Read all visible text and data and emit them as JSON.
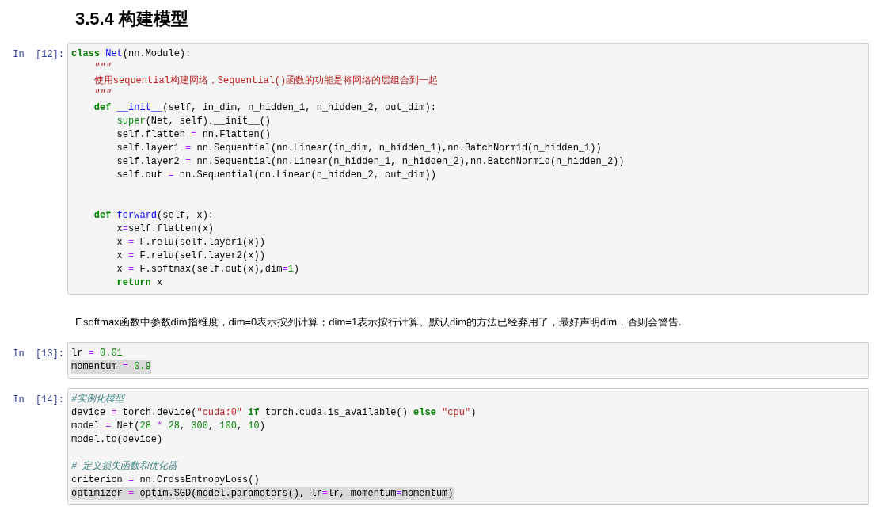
{
  "heading": "3.5.4 构建模型",
  "cells": [
    {
      "kind": "code",
      "prompt": "In  [12]:",
      "lines": [
        {
          "highlighted": false,
          "spans": [
            {
              "kind": "kw",
              "text": "class"
            },
            {
              "kind": "def",
              "text": " Net"
            },
            {
              "kind": "plain",
              "text": "(nn.Module):"
            }
          ]
        },
        {
          "highlighted": false,
          "spans": [
            {
              "kind": "doc",
              "text": "    \"\"\""
            }
          ]
        },
        {
          "highlighted": false,
          "spans": [
            {
              "kind": "str",
              "text": "    使用sequential构建网络，Sequential()函数的功能是将网络的层组合到一起"
            }
          ]
        },
        {
          "highlighted": false,
          "spans": [
            {
              "kind": "doc",
              "text": "    \"\"\""
            }
          ]
        },
        {
          "highlighted": false,
          "spans": [
            {
              "kind": "kw",
              "text": "    def"
            },
            {
              "kind": "def",
              "text": " __init__"
            },
            {
              "kind": "plain",
              "text": "(self, in_dim, n_hidden_1, n_hidden_2, out_dim):"
            }
          ]
        },
        {
          "highlighted": false,
          "spans": [
            {
              "kind": "builtin",
              "text": "        super"
            },
            {
              "kind": "plain",
              "text": "(Net, self).__init__()"
            }
          ]
        },
        {
          "highlighted": false,
          "spans": [
            {
              "kind": "plain",
              "text": "        self.flatten "
            },
            {
              "kind": "op",
              "text": "="
            },
            {
              "kind": "plain",
              "text": " nn.Flatten()"
            }
          ]
        },
        {
          "highlighted": false,
          "spans": [
            {
              "kind": "plain",
              "text": "        self.layer1 "
            },
            {
              "kind": "op",
              "text": "="
            },
            {
              "kind": "plain",
              "text": " nn.Sequential(nn.Linear(in_dim, n_hidden_1),nn.BatchNorm1d(n_hidden_1))"
            }
          ]
        },
        {
          "highlighted": false,
          "spans": [
            {
              "kind": "plain",
              "text": "        self.layer2 "
            },
            {
              "kind": "op",
              "text": "="
            },
            {
              "kind": "plain",
              "text": " nn.Sequential(nn.Linear(n_hidden_1, n_hidden_2),nn.BatchNorm1d(n_hidden_2))"
            }
          ]
        },
        {
          "highlighted": false,
          "spans": [
            {
              "kind": "plain",
              "text": "        self.out "
            },
            {
              "kind": "op",
              "text": "="
            },
            {
              "kind": "plain",
              "text": " nn.Sequential(nn.Linear(n_hidden_2, out_dim))"
            }
          ]
        },
        {
          "kind": "blank"
        },
        {
          "kind": "blank"
        },
        {
          "highlighted": false,
          "spans": [
            {
              "kind": "kw",
              "text": "    def"
            },
            {
              "kind": "def",
              "text": " forward"
            },
            {
              "kind": "plain",
              "text": "(self, x):"
            }
          ]
        },
        {
          "highlighted": false,
          "spans": [
            {
              "kind": "plain",
              "text": "        x"
            },
            {
              "kind": "op",
              "text": "="
            },
            {
              "kind": "plain",
              "text": "self.flatten(x)"
            }
          ]
        },
        {
          "highlighted": false,
          "spans": [
            {
              "kind": "plain",
              "text": "        x "
            },
            {
              "kind": "op",
              "text": "="
            },
            {
              "kind": "plain",
              "text": " F.relu(self.layer1(x))"
            }
          ]
        },
        {
          "highlighted": false,
          "spans": [
            {
              "kind": "plain",
              "text": "        x "
            },
            {
              "kind": "op",
              "text": "="
            },
            {
              "kind": "plain",
              "text": " F.relu(self.layer2(x))"
            }
          ]
        },
        {
          "highlighted": false,
          "spans": [
            {
              "kind": "plain",
              "text": "        x "
            },
            {
              "kind": "op",
              "text": "="
            },
            {
              "kind": "plain",
              "text": " F.softmax(self.out(x),dim"
            },
            {
              "kind": "op",
              "text": "="
            },
            {
              "kind": "num",
              "text": "1"
            },
            {
              "kind": "plain",
              "text": ")"
            }
          ]
        },
        {
          "highlighted": false,
          "spans": [
            {
              "kind": "kw",
              "text": "        return"
            },
            {
              "kind": "plain",
              "text": " x"
            }
          ]
        }
      ]
    },
    {
      "kind": "markdown",
      "text": "F.softmax函数中参数dim指维度，dim=0表示按列计算；dim=1表示按行计算。默认dim的方法已经弃用了，最好声明dim，否则会警告."
    },
    {
      "kind": "code",
      "prompt": "In  [13]:",
      "lines": [
        {
          "highlighted": false,
          "spans": [
            {
              "kind": "plain",
              "text": "lr "
            },
            {
              "kind": "op",
              "text": "="
            },
            {
              "kind": "num",
              "text": " 0.01"
            }
          ]
        },
        {
          "highlighted": true,
          "spans": [
            {
              "kind": "plain",
              "text": "momentum "
            },
            {
              "kind": "op",
              "text": "="
            },
            {
              "kind": "num",
              "text": " 0.9"
            }
          ]
        }
      ]
    },
    {
      "kind": "code",
      "prompt": "In  [14]:",
      "lines": [
        {
          "highlighted": false,
          "spans": [
            {
              "kind": "comment",
              "text": "#实例化模型"
            }
          ]
        },
        {
          "highlighted": false,
          "spans": [
            {
              "kind": "plain",
              "text": "device "
            },
            {
              "kind": "op",
              "text": "="
            },
            {
              "kind": "plain",
              "text": " torch.device("
            },
            {
              "kind": "str",
              "text": "\"cuda:0\""
            },
            {
              "kind": "kw",
              "text": " if"
            },
            {
              "kind": "plain",
              "text": " torch.cuda.is_available() "
            },
            {
              "kind": "kw",
              "text": "else"
            },
            {
              "kind": "str",
              "text": " \"cpu\""
            },
            {
              "kind": "plain",
              "text": ")"
            }
          ]
        },
        {
          "highlighted": false,
          "spans": [
            {
              "kind": "plain",
              "text": "model "
            },
            {
              "kind": "op",
              "text": "="
            },
            {
              "kind": "plain",
              "text": " Net("
            },
            {
              "kind": "num",
              "text": "28"
            },
            {
              "kind": "op",
              "text": " *"
            },
            {
              "kind": "num",
              "text": " 28"
            },
            {
              "kind": "plain",
              "text": ", "
            },
            {
              "kind": "num",
              "text": "300"
            },
            {
              "kind": "plain",
              "text": ", "
            },
            {
              "kind": "num",
              "text": "100"
            },
            {
              "kind": "plain",
              "text": ", "
            },
            {
              "kind": "num",
              "text": "10"
            },
            {
              "kind": "plain",
              "text": ")"
            }
          ]
        },
        {
          "highlighted": false,
          "spans": [
            {
              "kind": "plain",
              "text": "model.to(device)"
            }
          ]
        },
        {
          "kind": "blank"
        },
        {
          "highlighted": false,
          "spans": [
            {
              "kind": "comment",
              "text": "# 定义损失函数和优化器"
            }
          ]
        },
        {
          "highlighted": false,
          "spans": [
            {
              "kind": "plain",
              "text": "criterion "
            },
            {
              "kind": "op",
              "text": "="
            },
            {
              "kind": "plain",
              "text": " nn.CrossEntropyLoss()"
            }
          ]
        },
        {
          "highlighted": true,
          "spans": [
            {
              "kind": "plain",
              "text": "optimizer "
            },
            {
              "kind": "op",
              "text": "="
            },
            {
              "kind": "plain",
              "text": " optim.SGD(model.parameters(), lr"
            },
            {
              "kind": "op",
              "text": "="
            },
            {
              "kind": "plain",
              "text": "lr, momentum"
            },
            {
              "kind": "op",
              "text": "="
            },
            {
              "kind": "plain",
              "text": "momentum)"
            }
          ]
        }
      ]
    }
  ]
}
